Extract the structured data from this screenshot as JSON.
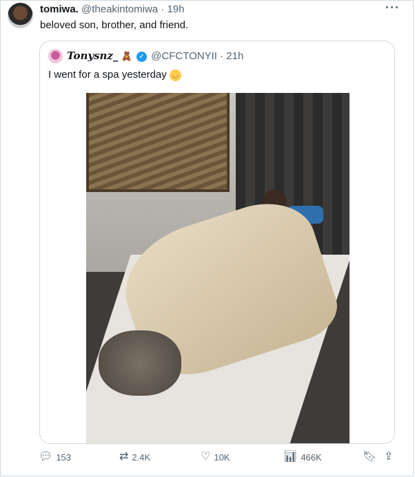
{
  "tweet": {
    "name": "tomiwa.",
    "handle": "@theakintomiwa",
    "time": "19h",
    "text": "beloved son, brother, and friend."
  },
  "quote": {
    "name": "Tonysnz_",
    "handle": "@CFCTONYII",
    "time": "21h",
    "text": "I went for a spa yesterday"
  },
  "actions": {
    "replies": "153",
    "retweets": "2.4K",
    "likes": "10K",
    "views": "466K"
  },
  "icons": [
    "more-icon",
    "verified-icon",
    "reply-icon",
    "retweet-icon",
    "like-icon",
    "views-icon",
    "bookmark-icon",
    "share-icon"
  ]
}
